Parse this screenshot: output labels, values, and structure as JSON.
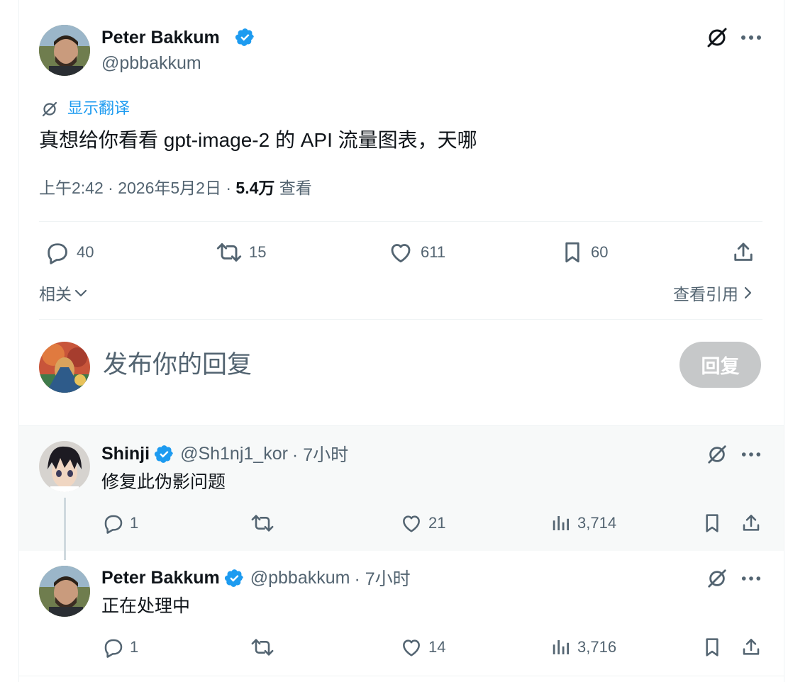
{
  "main_tweet": {
    "author_name": "Peter Bakkum",
    "author_handle": "@pbbakkum",
    "translate_label": "显示翻译",
    "text": "真想给你看看 gpt-image-2 的 API 流量图表，天哪",
    "time": "上午2:42 · 2026年5月2日 ·",
    "views_count": "5.4万",
    "views_label": "查看",
    "replies": "40",
    "retweets": "15",
    "likes": "611",
    "bookmarks": "60",
    "related_label": "相关",
    "quotes_label": "查看引用"
  },
  "composer": {
    "placeholder": "发布你的回复",
    "reply_button": "回复"
  },
  "replies": [
    {
      "author_name": "Shinji",
      "author_handle": "@Sh1nj1_kor",
      "time": "· 7小时",
      "text": "修复此伪影问题",
      "replies": "1",
      "retweets": "",
      "likes": "21",
      "views": "3,714"
    },
    {
      "author_name": "Peter Bakkum",
      "author_handle": "@pbbakkum",
      "time": "· 7小时",
      "text": "正在处理中",
      "replies": "1",
      "retweets": "",
      "likes": "14",
      "views": "3,716"
    }
  ],
  "colors": {
    "accent": "#1d9bf0",
    "text_primary": "#0f1419",
    "text_secondary": "#536471",
    "disabled_button": "#c6c8c9"
  },
  "icons": [
    "verified-badge-icon",
    "grok-icon",
    "more-icon",
    "reply-icon",
    "retweet-icon",
    "like-icon",
    "bookmark-icon",
    "share-icon",
    "views-icon",
    "chevron-down-icon",
    "chevron-right-icon",
    "translate-icon"
  ]
}
